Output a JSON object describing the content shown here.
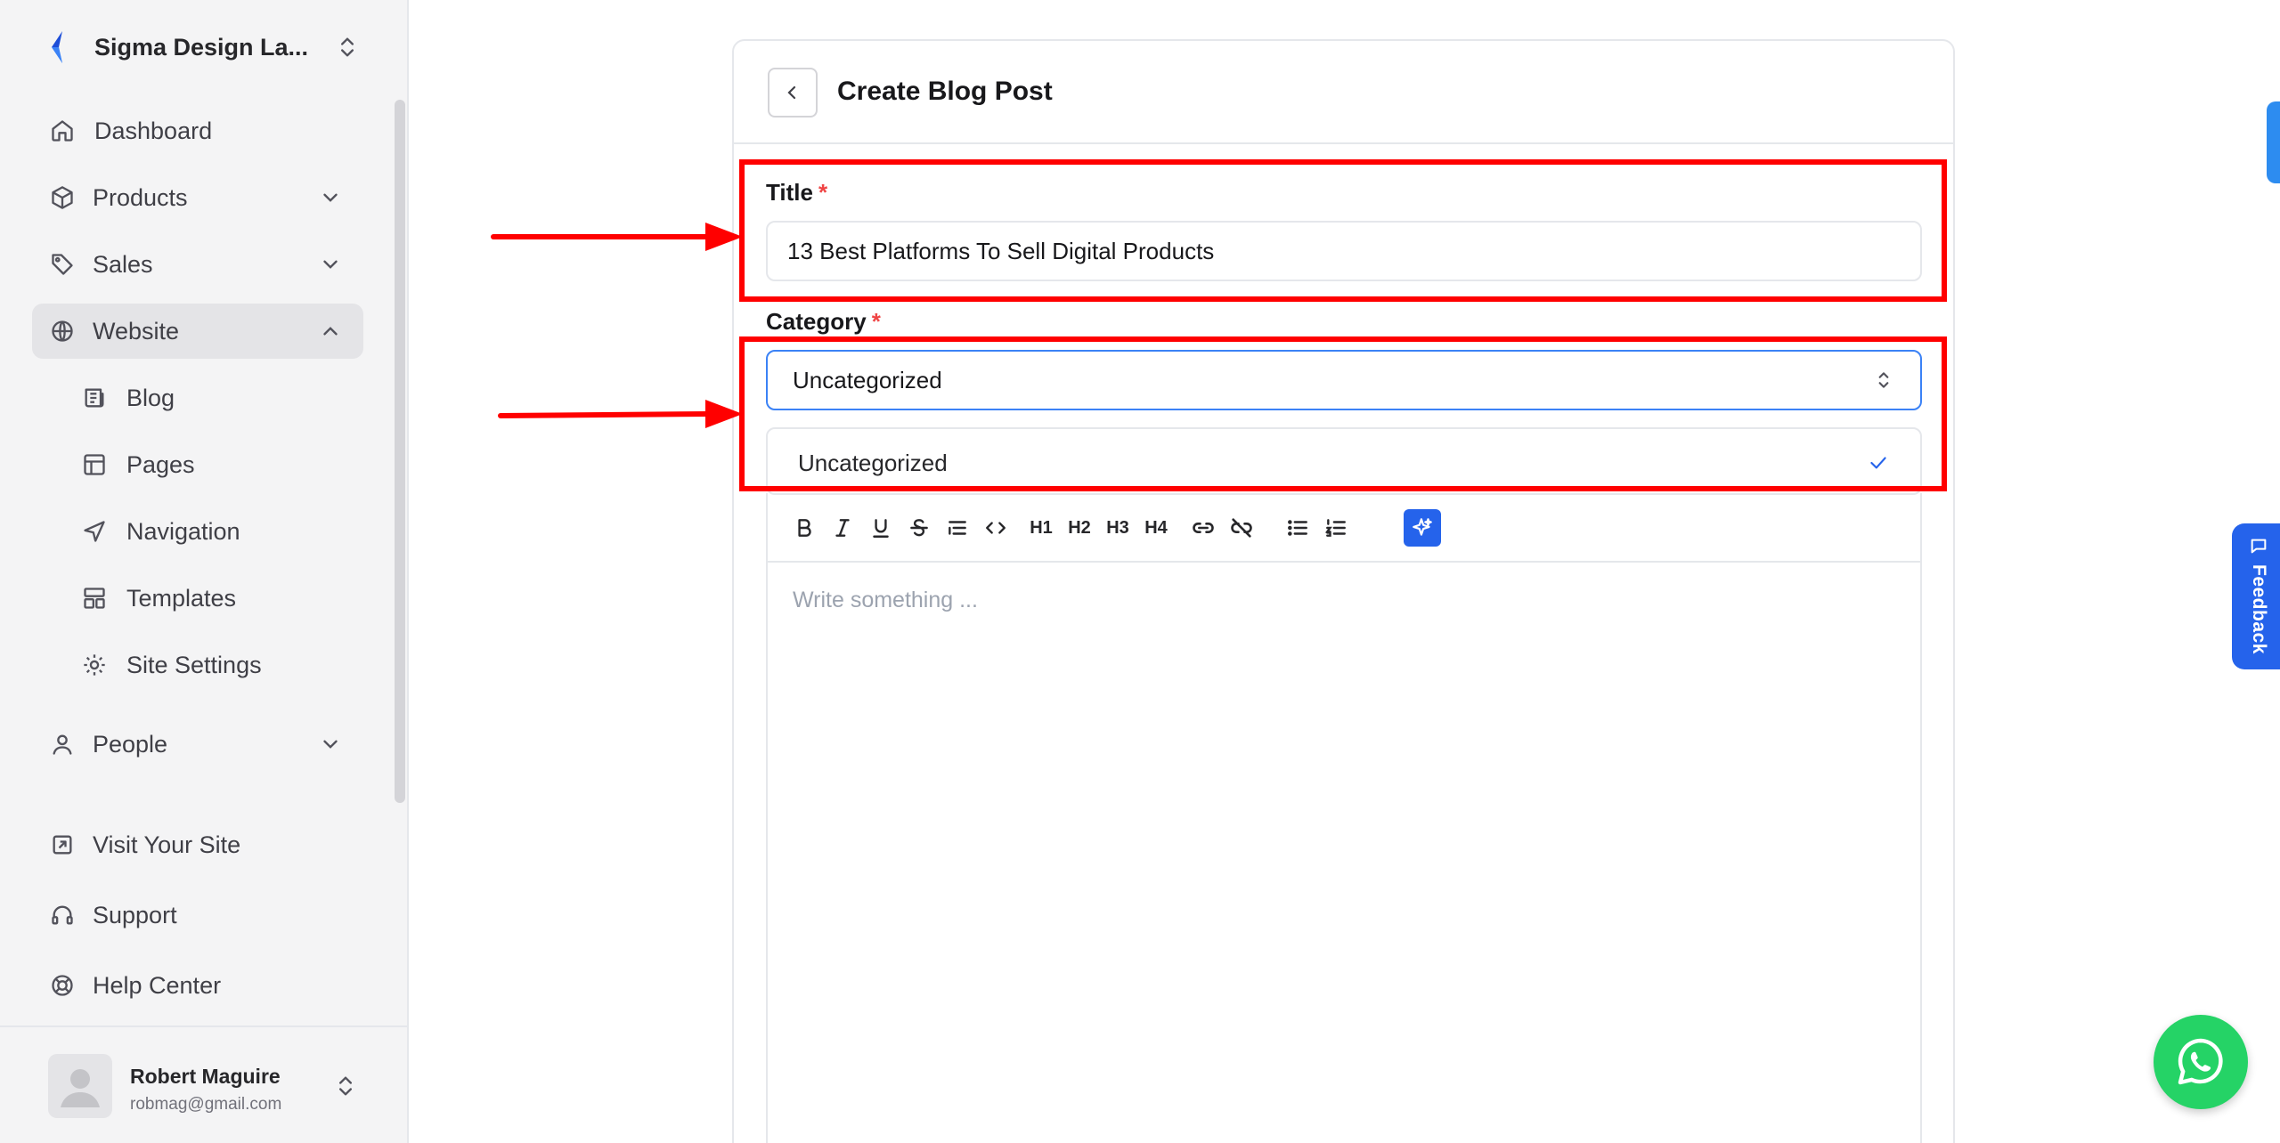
{
  "sidebar": {
    "workspace_name": "Sigma Design La...",
    "nav": [
      {
        "label": "Dashboard"
      },
      {
        "label": "Products"
      },
      {
        "label": "Sales"
      },
      {
        "label": "Website"
      },
      {
        "label": "Blog"
      },
      {
        "label": "Pages"
      },
      {
        "label": "Navigation"
      },
      {
        "label": "Templates"
      },
      {
        "label": "Site Settings"
      },
      {
        "label": "People"
      }
    ],
    "footer_links": [
      {
        "label": "Visit Your Site"
      },
      {
        "label": "Support"
      },
      {
        "label": "Help Center"
      }
    ],
    "user": {
      "name": "Robert Maguire",
      "email": "robmag@gmail.com"
    }
  },
  "page": {
    "title": "Create Blog Post",
    "title_field": {
      "label": "Title",
      "required_mark": "*",
      "value": "13 Best Platforms To Sell Digital Products"
    },
    "category_field": {
      "label": "Category",
      "required_mark": "*",
      "selected": "Uncategorized",
      "options": [
        "Uncategorized"
      ]
    },
    "editor": {
      "placeholder": "Write something ...",
      "toolbar": [
        "bold-icon",
        "italic-icon",
        "underline-icon",
        "strikethrough-icon",
        "blockquote-icon",
        "code-icon",
        "heading-1-icon",
        "heading-2-icon",
        "heading-3-icon",
        "heading-4-icon",
        "link-icon",
        "unlink-icon",
        "bullet-list-icon",
        "ordered-list-icon",
        "ai-sparkle-icon"
      ],
      "headings": [
        "H1",
        "H2",
        "H3",
        "H4"
      ]
    }
  },
  "widgets": {
    "feedback_label": "Feedback"
  },
  "colors": {
    "accent": "#2563eb",
    "annotation": "#ff0000",
    "whatsapp": "#25d366",
    "required": "#ef4444"
  }
}
